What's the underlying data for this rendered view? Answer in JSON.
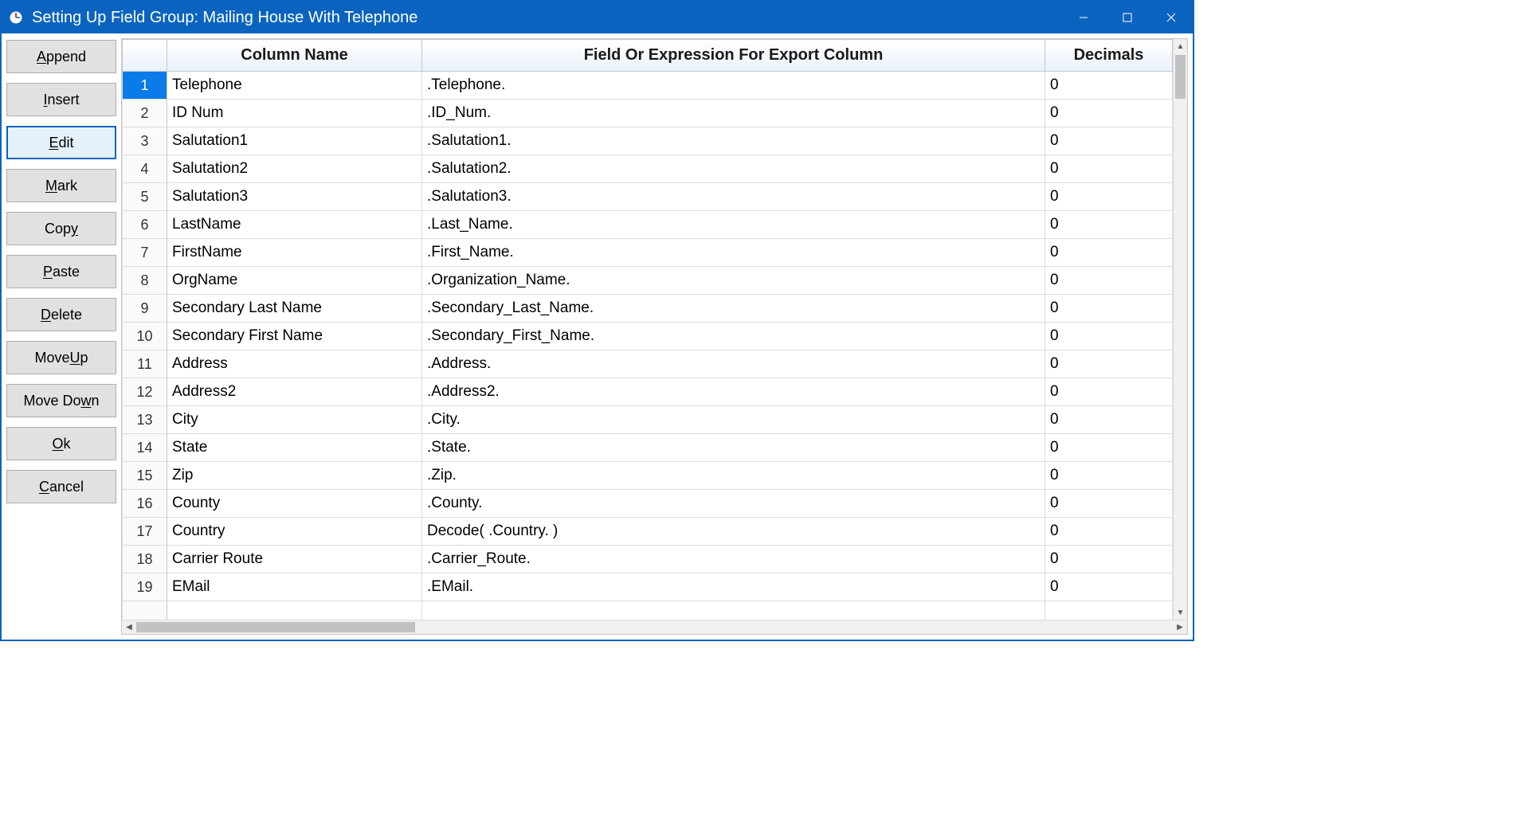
{
  "window": {
    "title": "Setting Up Field Group: Mailing House With Telephone"
  },
  "sidebar": {
    "buttons": [
      {
        "id": "append",
        "accel": "A",
        "before": "",
        "after": "ppend"
      },
      {
        "id": "insert",
        "accel": "I",
        "before": "",
        "after": "nsert"
      },
      {
        "id": "edit",
        "accel": "E",
        "before": "",
        "after": "dit",
        "focused": true
      },
      {
        "id": "mark",
        "accel": "M",
        "before": "",
        "after": "ark"
      },
      {
        "id": "copy",
        "accel": "y",
        "before": "Cop",
        "after": ""
      },
      {
        "id": "paste",
        "accel": "P",
        "before": "",
        "after": "aste"
      },
      {
        "id": "delete",
        "accel": "D",
        "before": "",
        "after": "elete"
      },
      {
        "id": "moveup",
        "accel": "U",
        "before": "Move ",
        "after": "p"
      },
      {
        "id": "movedown",
        "accel": "w",
        "before": "Move Do",
        "after": "n"
      },
      {
        "id": "ok",
        "accel": "O",
        "before": "",
        "after": "k"
      },
      {
        "id": "cancel",
        "accel": "C",
        "before": "",
        "after": "ancel"
      }
    ]
  },
  "grid": {
    "headers": {
      "rownum": "",
      "column_name": "Column Name",
      "expression": "Field Or Expression For Export Column",
      "decimals": "Decimals"
    },
    "rows": [
      {
        "n": "1",
        "name": "Telephone",
        "expr": ".Telephone.",
        "dec": "0"
      },
      {
        "n": "2",
        "name": "ID Num",
        "expr": ".ID_Num.",
        "dec": "0"
      },
      {
        "n": "3",
        "name": "Salutation1",
        "expr": ".Salutation1.",
        "dec": "0"
      },
      {
        "n": "4",
        "name": "Salutation2",
        "expr": ".Salutation2.",
        "dec": "0"
      },
      {
        "n": "5",
        "name": "Salutation3",
        "expr": ".Salutation3.",
        "dec": "0"
      },
      {
        "n": "6",
        "name": "LastName",
        "expr": ".Last_Name.",
        "dec": "0"
      },
      {
        "n": "7",
        "name": "FirstName",
        "expr": ".First_Name.",
        "dec": "0"
      },
      {
        "n": "8",
        "name": "OrgName",
        "expr": ".Organization_Name.",
        "dec": "0"
      },
      {
        "n": "9",
        "name": "Secondary Last Name",
        "expr": ".Secondary_Last_Name.",
        "dec": "0"
      },
      {
        "n": "10",
        "name": "Secondary First Name",
        "expr": ".Secondary_First_Name.",
        "dec": "0"
      },
      {
        "n": "11",
        "name": "Address",
        "expr": ".Address.",
        "dec": "0"
      },
      {
        "n": "12",
        "name": "Address2",
        "expr": ".Address2.",
        "dec": "0"
      },
      {
        "n": "13",
        "name": "City",
        "expr": ".City.",
        "dec": "0"
      },
      {
        "n": "14",
        "name": "State",
        "expr": ".State.",
        "dec": "0"
      },
      {
        "n": "15",
        "name": "Zip",
        "expr": ".Zip.",
        "dec": "0"
      },
      {
        "n": "16",
        "name": "County",
        "expr": ".County.",
        "dec": "0"
      },
      {
        "n": "17",
        "name": "Country",
        "expr": "Decode( .Country. )",
        "dec": "0"
      },
      {
        "n": "18",
        "name": "Carrier Route",
        "expr": ".Carrier_Route.",
        "dec": "0"
      },
      {
        "n": "19",
        "name": "EMail",
        "expr": ".EMail.",
        "dec": "0"
      }
    ]
  }
}
